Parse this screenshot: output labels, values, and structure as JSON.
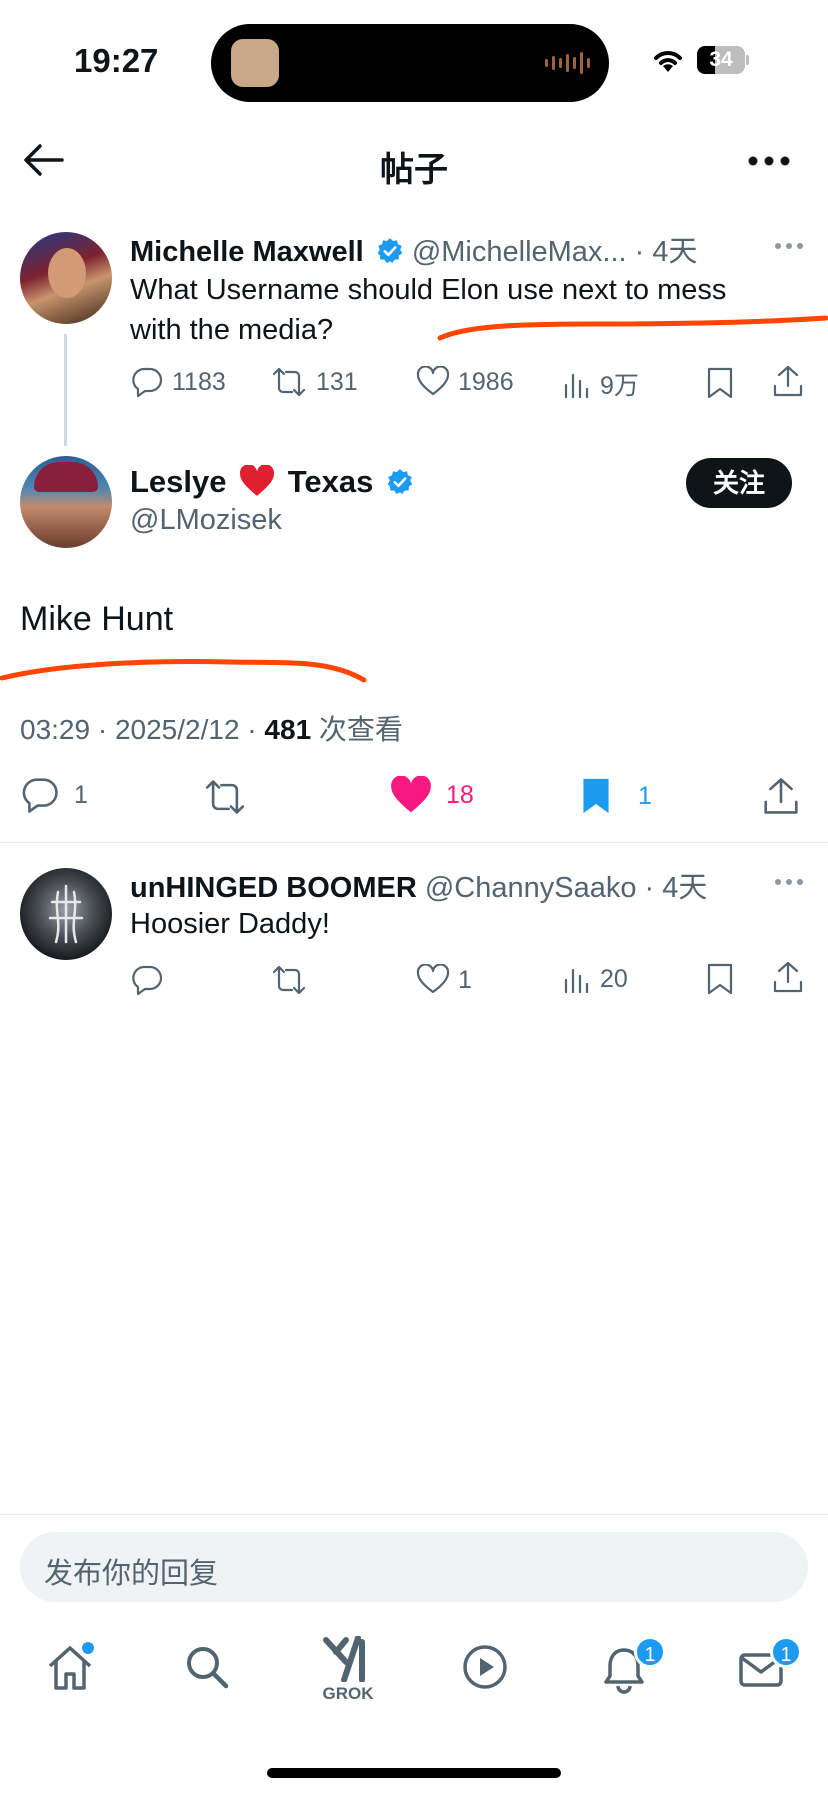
{
  "status_bar": {
    "time": "19:27",
    "battery": "34"
  },
  "header": {
    "title": "帖子"
  },
  "parent_tweet": {
    "name": "Michelle Maxwell",
    "handle": "@MichelleMax...",
    "time": "· 4天",
    "text_line1": "What Username should Elon use next to mess",
    "text_line2": "with the media?",
    "stats": {
      "replies": "1183",
      "retweets": "131",
      "likes": "1986",
      "views": "9万"
    }
  },
  "main_tweet": {
    "name": "Leslye",
    "heart_emoji": "❤️",
    "name_suffix": "Texas",
    "handle": "@LMozisek",
    "follow_label": "关注",
    "text": "Mike Hunt",
    "timestamp_time": "03:29",
    "timestamp_date": "· 2025/2/12 ·",
    "views_count": "481",
    "views_label": "次查看",
    "stats": {
      "replies": "1",
      "likes": "18",
      "bookmarks": "1"
    },
    "colors": {
      "like": "#f91880",
      "bookmark": "#1d9bf0"
    }
  },
  "reply_tweet": {
    "name": "unHINGED BOOMER",
    "handle": "@ChannySaako",
    "time": "· 4天",
    "text": "Hoosier Daddy!",
    "stats": {
      "likes": "1",
      "views": "20"
    }
  },
  "composer": {
    "placeholder": "发布你的回复"
  },
  "bottom_nav": {
    "items": [
      "home-icon",
      "search-icon",
      "grok-icon",
      "play-icon",
      "bell-icon",
      "mail-icon"
    ],
    "grok_label": "GROK",
    "notifications_badge": "1",
    "messages_badge": "1"
  },
  "annotation_color": "#ff4500"
}
